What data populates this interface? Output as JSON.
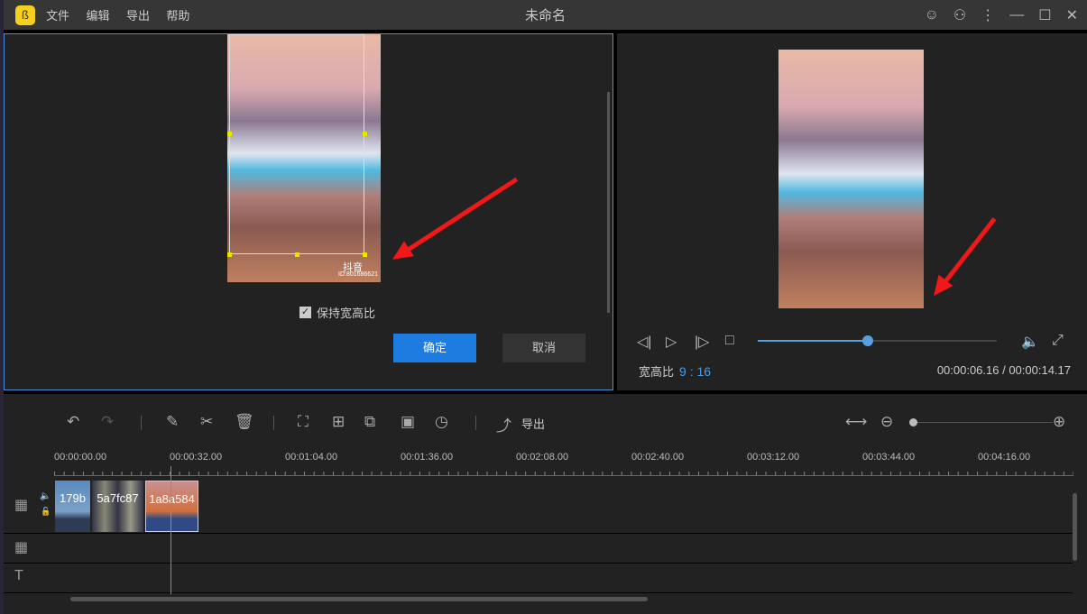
{
  "app": {
    "title": "未命名",
    "menu": [
      "文件",
      "编辑",
      "导出",
      "帮助"
    ]
  },
  "crop": {
    "keep_ratio_label": "保持宽高比",
    "keep_ratio_checked": true,
    "confirm": "确定",
    "cancel": "取消",
    "watermark": "抖音",
    "watermark_id": "ID:801686621"
  },
  "preview": {
    "aspect_label": "宽高比",
    "aspect_value": "9 : 16",
    "time": "00:00:06.16 / 00:00:14.17",
    "progress": 0.46
  },
  "toolbar": {
    "export_label": "导出",
    "zoom_level": 0.0
  },
  "timeline": {
    "ruler": [
      "00:00:00.00",
      "00:00:32.00",
      "00:01:04.00",
      "00:01:36.00",
      "00:02:08.00",
      "00:02:40.00",
      "00:03:12.00",
      "00:03:44.00",
      "00:04:16.00"
    ],
    "clips": [
      "179b",
      "5a7fc87",
      "1a8a584"
    ]
  },
  "colors": {
    "accent": "#1e7ce0",
    "arrow": "#f01818",
    "selected_clip": "#e6e600"
  }
}
